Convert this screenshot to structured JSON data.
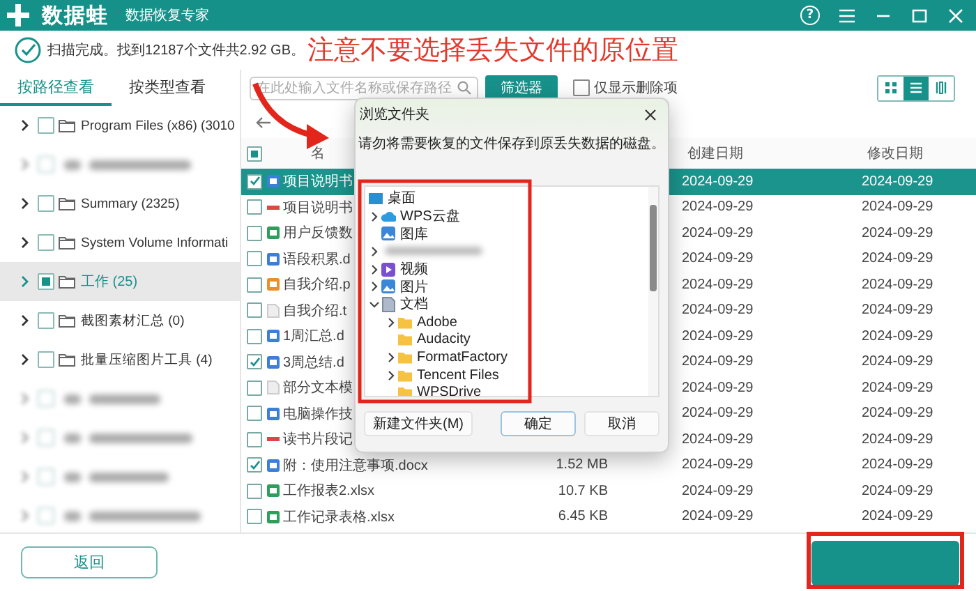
{
  "header": {
    "logo": "数据蛙",
    "subtitle": "数据恢复专家",
    "help_glyph": "?"
  },
  "status": {
    "message": "扫描完成。找到12187个文件共2.92 GB。"
  },
  "annotation": {
    "note": "注意不要选择丢失文件的原位置"
  },
  "view_tabs": [
    {
      "label": "按路径查看",
      "selected": true
    },
    {
      "label": "按类型查看",
      "selected": false
    }
  ],
  "toolbar": {
    "search": {
      "placeholder": "在此处输入文件名称或保存路径"
    },
    "filter_button": "筛选器",
    "deleted_only": {
      "label": "仅显示删除项",
      "checked": false
    },
    "view_modes": [
      {
        "kind": "grid",
        "selected": false
      },
      {
        "kind": "list",
        "selected": true
      },
      {
        "kind": "detail",
        "selected": false
      }
    ]
  },
  "folder_tree": [
    {
      "kind": "folder",
      "label": "Program Files (x86) (3010",
      "partial": false,
      "selected": false
    },
    {
      "kind": "blurred",
      "partial": false,
      "selected": false
    },
    {
      "kind": "folder",
      "label": "Summary (2325)",
      "partial": false,
      "selected": false
    },
    {
      "kind": "folder",
      "label": "System Volume Informati",
      "partial": false,
      "selected": false
    },
    {
      "kind": "folder",
      "label": "工作 (25)",
      "partial": true,
      "selected": true
    },
    {
      "kind": "folder",
      "label": "截图素材汇总 (0)",
      "partial": false,
      "selected": false
    },
    {
      "kind": "folder",
      "label": "批量压缩图片工具 (4)",
      "partial": false,
      "selected": false
    },
    {
      "kind": "blurred",
      "partial": false,
      "selected": false
    },
    {
      "kind": "blurred",
      "partial": false,
      "selected": false
    },
    {
      "kind": "blurred",
      "partial": false,
      "selected": false
    },
    {
      "kind": "blurred",
      "partial": false,
      "selected": false
    }
  ],
  "table": {
    "select_all_partial": true,
    "columns": [
      {
        "kind": "name",
        "label": "名"
      },
      {
        "kind": "created",
        "label": "创建日期"
      },
      {
        "kind": "modified",
        "label": "修改日期"
      }
    ],
    "rows": [
      {
        "kind": "word",
        "name": "项目说明书",
        "created": "2024-09-29",
        "modified": "2024-09-29",
        "checked": true,
        "selected": true
      },
      {
        "kind": "pdf",
        "name": "项目说明书",
        "created": "2024-09-29",
        "modified": "2024-09-29",
        "checked": false,
        "selected": false
      },
      {
        "kind": "sheet",
        "name": "用户反馈数",
        "created": "2024-09-29",
        "modified": "2024-09-29",
        "checked": false,
        "selected": false
      },
      {
        "kind": "word",
        "name": "语段积累.d",
        "created": "2024-09-29",
        "modified": "2024-09-29",
        "checked": false,
        "selected": false
      },
      {
        "kind": "slides",
        "name": "自我介绍.p",
        "created": "2024-09-29",
        "modified": "2024-09-29",
        "checked": false,
        "selected": false
      },
      {
        "kind": "text",
        "name": "自我介绍.t",
        "created": "2024-09-29",
        "modified": "2024-09-29",
        "checked": false,
        "selected": false
      },
      {
        "kind": "word",
        "name": "1周汇总.d",
        "created": "2024-09-29",
        "modified": "2024-09-29",
        "checked": false,
        "selected": false
      },
      {
        "kind": "word",
        "name": "3周总结.d",
        "created": "2024-09-29",
        "modified": "2024-09-29",
        "checked": true,
        "selected": false
      },
      {
        "kind": "text",
        "name": "部分文本模",
        "created": "2024-09-29",
        "modified": "2024-09-29",
        "checked": false,
        "selected": false
      },
      {
        "kind": "word",
        "name": "电脑操作技",
        "created": "2024-09-29",
        "modified": "2024-09-29",
        "checked": false,
        "selected": false
      },
      {
        "kind": "pdf",
        "name": "读书片段记",
        "created": "2024-09-29",
        "modified": "2024-09-29",
        "checked": false,
        "selected": false
      },
      {
        "kind": "word",
        "name": "附：使用注意事项.docx",
        "size": "1.52 MB",
        "created": "2024-09-29",
        "modified": "2024-09-29",
        "checked": true,
        "selected": false
      },
      {
        "kind": "sheet",
        "name": "工作报表2.xlsx",
        "size": "10.7 KB",
        "created": "2024-09-29",
        "modified": "2024-09-29",
        "checked": false,
        "selected": false
      },
      {
        "kind": "sheet",
        "name": "工作记录表格.xlsx",
        "size": "6.45 KB",
        "created": "2024-09-29",
        "modified": "2024-09-29",
        "checked": false,
        "selected": false
      }
    ]
  },
  "dialog": {
    "title": "浏览文件夹",
    "message": "请勿将需要恢复的文件保存到原丢失数据的磁盘。",
    "tree": [
      {
        "kind": "desktop",
        "label": "桌面",
        "children": [
          {
            "kind": "cloud",
            "label": "WPS云盘",
            "expanded": false
          },
          {
            "kind": "gallery",
            "label": "图库"
          },
          {
            "kind": "blurred",
            "expanded": false
          },
          {
            "kind": "video",
            "label": "视频",
            "expanded": false
          },
          {
            "kind": "pictures",
            "label": "图片",
            "expanded": false
          },
          {
            "kind": "documents",
            "label": "文档",
            "expanded": true,
            "children": [
              {
                "kind": "folder",
                "label": "Adobe",
                "expanded": false
              },
              {
                "kind": "folder",
                "label": "Audacity"
              },
              {
                "kind": "folder",
                "label": "FormatFactory",
                "expanded": false
              },
              {
                "kind": "folder",
                "label": "Tencent Files",
                "expanded": false
              },
              {
                "kind": "folder",
                "label": "WPSDrive"
              }
            ]
          }
        ]
      }
    ],
    "buttons": [
      {
        "label": "新建文件夹(M)",
        "focused": false
      },
      {
        "label": "确定",
        "focused": true
      },
      {
        "label": "取消",
        "focused": false
      }
    ]
  },
  "bottom_bar": {
    "back_button": "返回"
  }
}
